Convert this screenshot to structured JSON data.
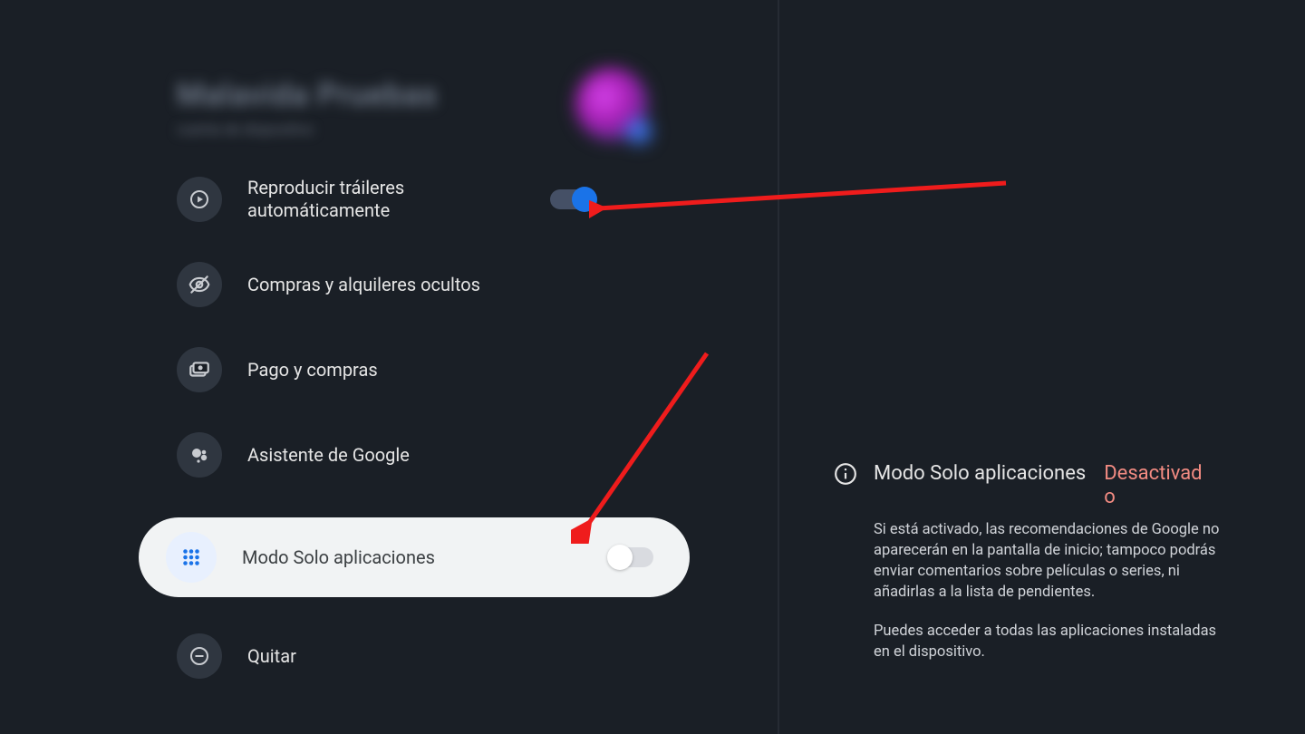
{
  "header": {
    "blur_name": "Malavida Pruebas",
    "blur_sub": "cuenta de dispositivo"
  },
  "items": {
    "autoplay": {
      "label": "Reproducir tráileres automáticamente",
      "toggle_on": true
    },
    "hidden": {
      "label": "Compras y alquileres ocultos"
    },
    "payment": {
      "label": "Pago y compras"
    },
    "assistant": {
      "label": "Asistente de Google"
    },
    "apps_only": {
      "label": "Modo Solo aplicaciones",
      "toggle_on": false
    },
    "remove": {
      "label": "Quitar"
    }
  },
  "detail": {
    "title": "Modo Solo aplicaciones",
    "status": "Desactivado",
    "para1": "Si está activado, las recomendaciones de Google no aparecerán en la pantalla de inicio; tampoco podrás enviar comentarios sobre películas o series, ni añadirlas a la lista de pendientes.",
    "para2": "Puedes acceder a todas las aplicaciones instaladas en el dispositivo."
  }
}
